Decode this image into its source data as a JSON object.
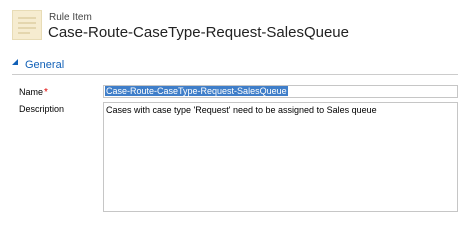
{
  "header": {
    "entity_type": "Rule Item",
    "record_title": "Case-Route-CaseType-Request-SalesQueue"
  },
  "section": {
    "title": "General",
    "expanded": true
  },
  "fields": {
    "name": {
      "label": "Name",
      "required_mark": "*",
      "value": "Case-Route-CaseType-Request-SalesQueue",
      "selected": true
    },
    "description": {
      "label": "Description",
      "value": "Cases with case type 'Request' need to be assigned to Sales queue"
    }
  },
  "colors": {
    "accent": "#1160b7",
    "selection": "#3f7ec9",
    "required": "#e00000",
    "icon_bg": "#f6ecd0"
  },
  "icons": {
    "entity": "rule-item-icon",
    "section_toggle": "triangle-down-icon"
  }
}
